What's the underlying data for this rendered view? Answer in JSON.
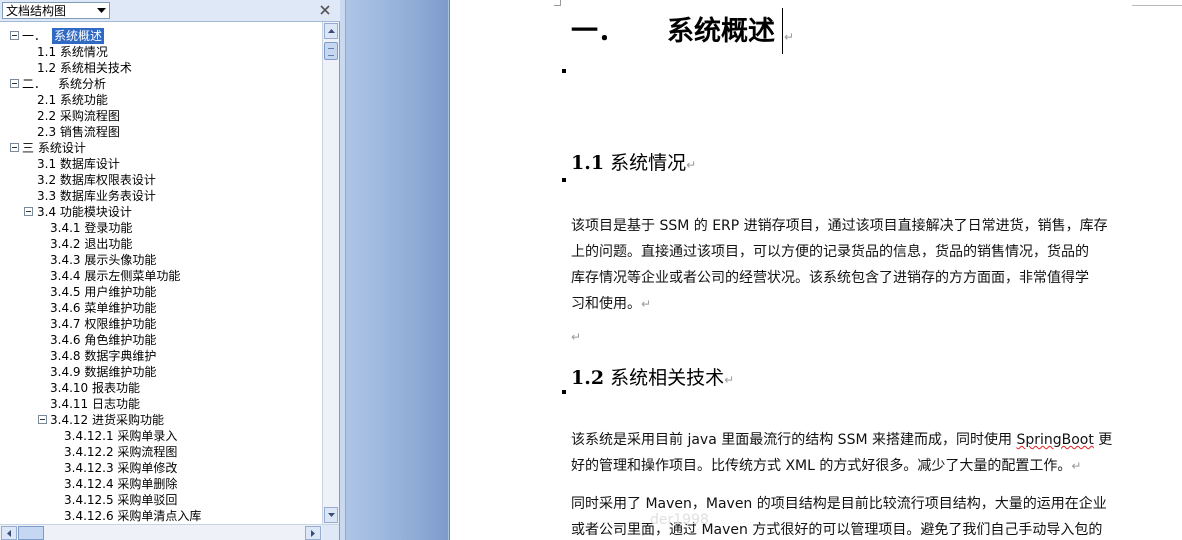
{
  "nav": {
    "view_select_value": "文档结构图",
    "close_label": "×",
    "tree": [
      {
        "label": "一．  系统概述",
        "level": 0,
        "toggle": true,
        "selected": true,
        "split": true,
        "num": "一．",
        "text": "系统概述"
      },
      {
        "label": "1.1 系统情况",
        "level": 1
      },
      {
        "label": "1.2 系统相关技术",
        "level": 1
      },
      {
        "label": "二．  系统分析",
        "level": 0,
        "toggle": true,
        "split": true,
        "num": "二．",
        "text": "系统分析"
      },
      {
        "label": "2.1 系统功能",
        "level": 1
      },
      {
        "label": "2.2 采购流程图",
        "level": 1
      },
      {
        "label": "2.3 销售流程图",
        "level": 1
      },
      {
        "label": "三 系统设计",
        "level": 0,
        "toggle": true
      },
      {
        "label": "3.1 数据库设计",
        "level": 1
      },
      {
        "label": "3.2 数据库权限表设计",
        "level": 1
      },
      {
        "label": "3.3 数据库业务表设计",
        "level": 1
      },
      {
        "label": "3.4 功能模块设计",
        "level": 1,
        "toggle": true
      },
      {
        "label": "3.4.1 登录功能",
        "level": 2
      },
      {
        "label": "3.4.2 退出功能",
        "level": 2
      },
      {
        "label": "3.4.3 展示头像功能",
        "level": 2
      },
      {
        "label": "3.4.4 展示左侧菜单功能",
        "level": 2
      },
      {
        "label": "3.4.5 用户维护功能",
        "level": 2
      },
      {
        "label": "3.4.6 菜单维护功能",
        "level": 2
      },
      {
        "label": "3.4.7 权限维护功能",
        "level": 2
      },
      {
        "label": "3.4.6 角色维护功能",
        "level": 2
      },
      {
        "label": "3.4.8 数据字典维护",
        "level": 2
      },
      {
        "label": "3.4.9 数据维护功能",
        "level": 2
      },
      {
        "label": "3.4.10 报表功能",
        "level": 2
      },
      {
        "label": "3.4.11 日志功能",
        "level": 2
      },
      {
        "label": "3.4.12 进货采购功能",
        "level": 2,
        "toggle": true
      },
      {
        "label": "3.4.12.1 采购单录入",
        "level": 3
      },
      {
        "label": "3.4.12.2 采购流程图",
        "level": 3
      },
      {
        "label": "3.4.12.3 采购单修改",
        "level": 3
      },
      {
        "label": "3.4.12.4 采购单删除",
        "level": 3
      },
      {
        "label": "3.4.12.5 采购单驳回",
        "level": 3
      },
      {
        "label": "3.4.12.6 采购单清点入库",
        "level": 3
      }
    ]
  },
  "document": {
    "heading1": {
      "number": "一．",
      "text": "系统概述"
    },
    "section_1_1": {
      "number": "1.1",
      "title": "系统情况"
    },
    "section_1_1_body": [
      "该项目是基于 SSM 的 ERP 进销存项目，通过该项目直接解决了日常进货，销售，库存",
      "上的问题。直接通过该项目，可以方便的记录货品的信息，货品的销售情况，货品的",
      "库存情况等企业或者公司的经营状况。该系统包含了进销存的方方面面，非常值得学",
      "习和使用。"
    ],
    "section_1_2": {
      "number": "1.2",
      "title": "系统相关技术"
    },
    "section_1_2_body_a": {
      "line1_before": "该系统是采用目前 java 里面最流行的结构 SSM 来搭建而成，同时使用 ",
      "line1_misspelled": "SpringBoot",
      "line1_after": " 更",
      "line2": "好的管理和操作项目。比传统方式 XML 的方式好很多。减少了大量的配置工作。"
    },
    "section_1_2_body_b": [
      "同时采用了 Maven，Maven 的项目结构是目前比较流行项目结构，大量的运用在企业",
      "或者公司里面，通过 Maven 方式很好的可以管理项目。避免了我们自己手动导入包的"
    ],
    "pilcrow": "↵",
    "watermark": "der1998"
  }
}
